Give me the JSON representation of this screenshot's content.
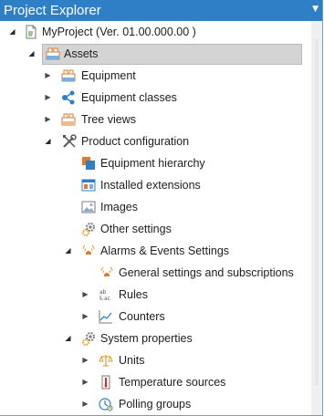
{
  "panel": {
    "title": "Project Explorer",
    "pin_icon": "dropdown-arrow-icon"
  },
  "tree": {
    "project": "MyProject (Ver. 01.00.000.00 )",
    "assets": "Assets",
    "equipment": "Equipment",
    "equipment_classes": "Equipment classes",
    "tree_views": "Tree views",
    "product_configuration": "Product configuration",
    "equipment_hierarchy": "Equipment hierarchy",
    "installed_extensions": "Installed extensions",
    "images": "Images",
    "other_settings": "Other settings",
    "alarms_events_settings": "Alarms & Events Settings",
    "general_settings_subscriptions": "General settings and subscriptions",
    "rules": "Rules",
    "counters": "Counters",
    "system_properties": "System properties",
    "units": "Units",
    "temperature_sources": "Temperature sources",
    "polling_groups": "Polling groups"
  },
  "colors": {
    "titlebar": "#2f7fc7",
    "selection": "#d4d4d4",
    "accent_orange": "#e07a2e",
    "accent_blue": "#2f7fc7"
  }
}
